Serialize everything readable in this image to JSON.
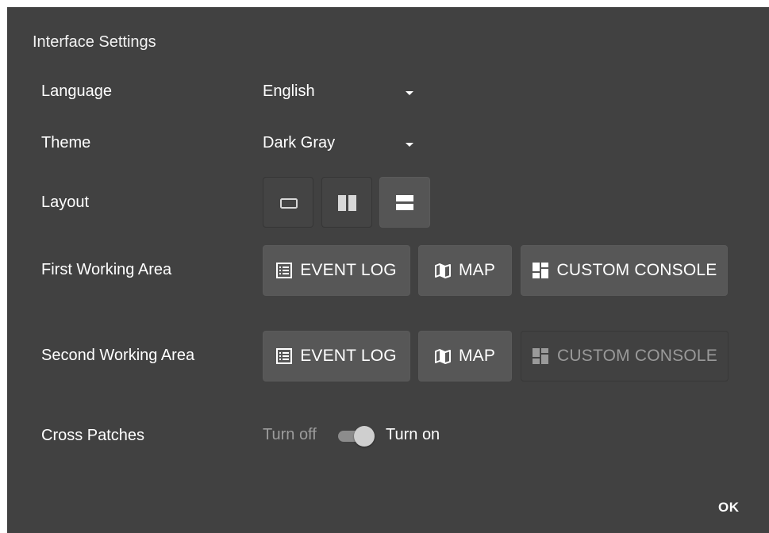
{
  "dialog": {
    "title": "Interface Settings",
    "ok_label": "OK"
  },
  "language": {
    "label": "Language",
    "value": "English"
  },
  "theme": {
    "label": "Theme",
    "value": "Dark Gray"
  },
  "layout": {
    "label": "Layout",
    "selected": "horizontal-split"
  },
  "first_area": {
    "label": "First Working Area",
    "buttons": [
      "EVENT LOG",
      "MAP",
      "CUSTOM CONSOLE"
    ]
  },
  "second_area": {
    "label": "Second Working Area",
    "buttons": [
      "EVENT LOG",
      "MAP",
      "CUSTOM CONSOLE"
    ],
    "disabled": [
      "CUSTOM CONSOLE"
    ]
  },
  "cross_patches": {
    "label": "Cross Patches",
    "off_label": "Turn off",
    "on_label": "Turn on",
    "state": "on"
  },
  "colors": {
    "dialog_bg": "#414141",
    "button_bg": "#575757",
    "text": "#ffffff",
    "muted_text": "#9c9c9c"
  },
  "icons": [
    "caret-down-icon",
    "single-pane-icon",
    "vertical-split-icon",
    "horizontal-split-icon",
    "list-icon",
    "map-icon",
    "dashboard-icon"
  ]
}
